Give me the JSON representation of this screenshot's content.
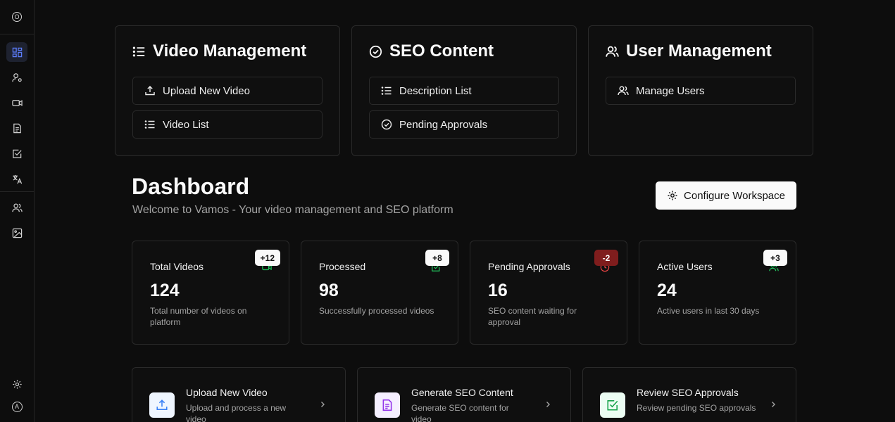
{
  "sidebar": {
    "logo": "O",
    "avatar": "A",
    "items": [
      {
        "icon": "dashboard-grid-icon",
        "active": true
      },
      {
        "icon": "user-settings-icon",
        "active": false
      },
      {
        "icon": "video-camera-icon",
        "active": false
      },
      {
        "icon": "document-icon",
        "active": false
      },
      {
        "icon": "check-square-icon",
        "active": false
      },
      {
        "icon": "translate-icon",
        "active": false
      },
      {
        "icon": "users-icon",
        "active": false
      },
      {
        "icon": "image-icon",
        "active": false
      }
    ]
  },
  "top_cards": [
    {
      "title": "Video Management",
      "icon": "list-icon",
      "buttons": [
        {
          "label": "Upload New Video",
          "icon": "upload-icon"
        },
        {
          "label": "Video List",
          "icon": "list-icon"
        }
      ]
    },
    {
      "title": "SEO Content",
      "icon": "check-circle-icon",
      "buttons": [
        {
          "label": "Description List",
          "icon": "list-icon"
        },
        {
          "label": "Pending Approvals",
          "icon": "check-circle-icon"
        }
      ]
    },
    {
      "title": "User Management",
      "icon": "users-icon",
      "buttons": [
        {
          "label": "Manage Users",
          "icon": "users-icon"
        }
      ]
    }
  ],
  "dashboard": {
    "title": "Dashboard",
    "subtitle": "Welcome to Vamos - Your video management and SEO platform",
    "configure_label": "Configure Workspace"
  },
  "stats": [
    {
      "label": "Total Videos",
      "value": "124",
      "badge": "+12",
      "desc": "Total number of videos on platform",
      "icon": "video-icon",
      "icon_color": "#22c55e"
    },
    {
      "label": "Processed",
      "value": "98",
      "badge": "+8",
      "desc": "Successfully processed videos",
      "icon": "check-square-icon",
      "icon_color": "#22c55e"
    },
    {
      "label": "Pending Approvals",
      "value": "16",
      "badge": "-2",
      "desc": "SEO content waiting for approval",
      "icon": "clock-icon",
      "icon_color": "#ef4444"
    },
    {
      "label": "Active Users",
      "value": "24",
      "badge": "+3",
      "desc": "Active users in last 30 days",
      "icon": "users-icon",
      "icon_color": "#22c55e"
    }
  ],
  "actions": [
    {
      "title": "Upload New Video",
      "desc": "Upload and process a new video",
      "icon": "upload-icon",
      "color": "#3b82f6",
      "bg": "#eff6ff"
    },
    {
      "title": "Generate SEO Content",
      "desc": "Generate SEO content for video",
      "icon": "document-icon",
      "color": "#9333ea",
      "bg": "#f5efff"
    },
    {
      "title": "Review SEO Approvals",
      "desc": "Review pending SEO approvals",
      "icon": "check-square-icon",
      "color": "#16a34a",
      "bg": "#ecfdf3"
    }
  ]
}
